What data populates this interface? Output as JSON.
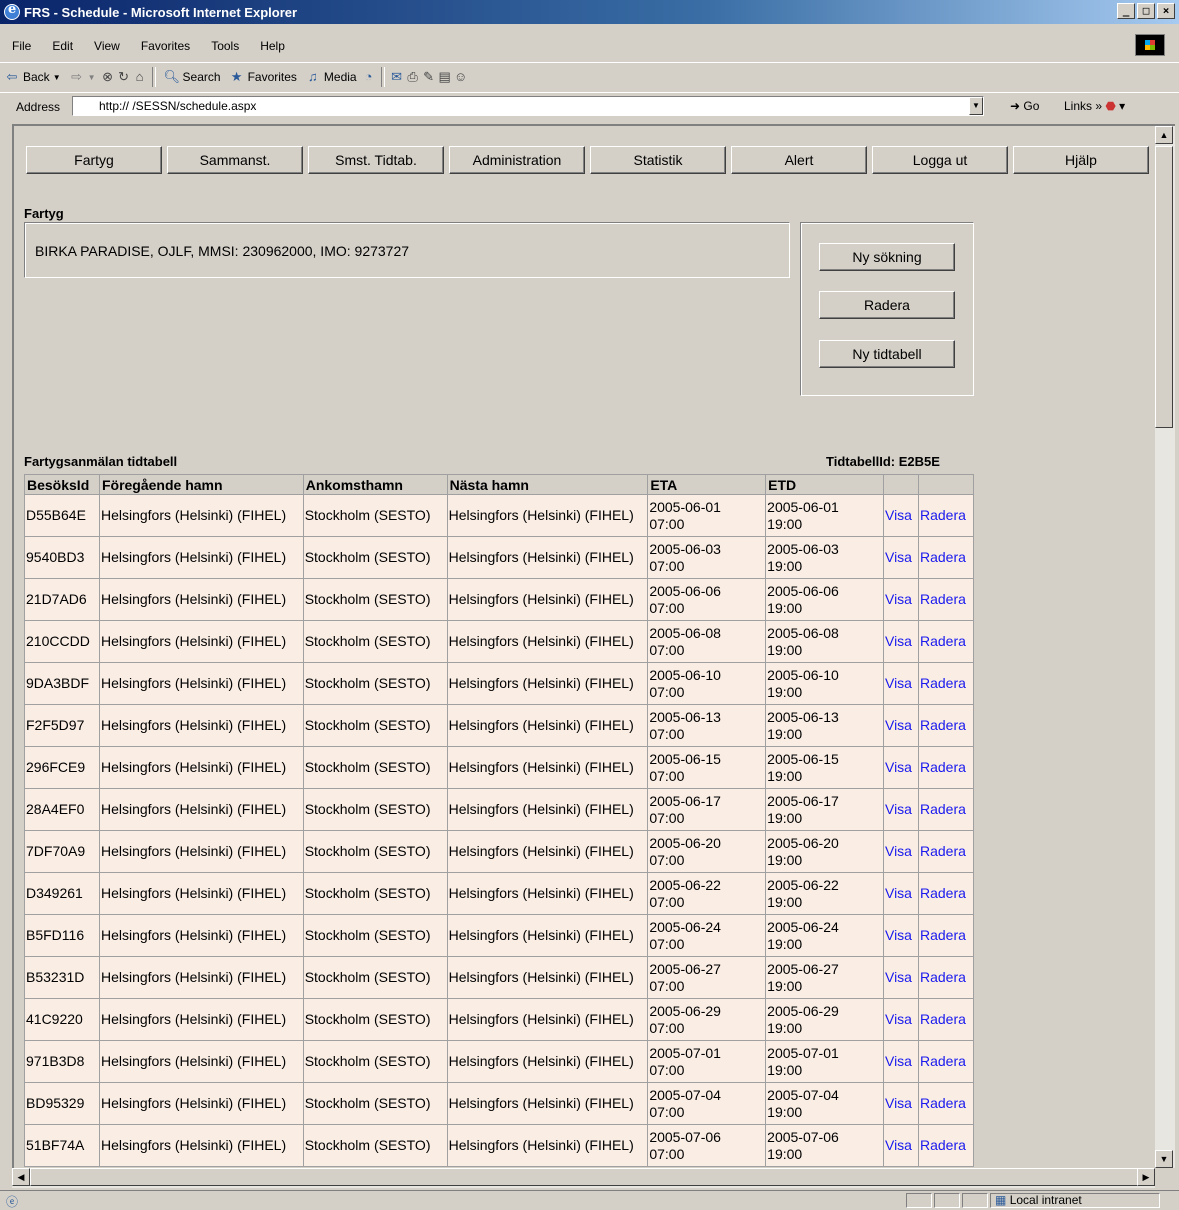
{
  "window": {
    "title": "FRS - Schedule - Microsoft Internet Explorer"
  },
  "menu": [
    "File",
    "Edit",
    "View",
    "Favorites",
    "Tools",
    "Help"
  ],
  "toolbar": {
    "back": "Back",
    "search": "Search",
    "favorites": "Favorites",
    "media": "Media"
  },
  "address": {
    "label": "Address",
    "url": "http://   /SESSN/schedule.aspx",
    "go": "Go",
    "links": "Links"
  },
  "nav": [
    "Fartyg",
    "Sammanst.",
    "Smst. Tidtab.",
    "Administration",
    "Statistik",
    "Alert",
    "Logga ut",
    "Hjälp"
  ],
  "vessel": {
    "heading": "Fartyg",
    "info": "BIRKA PARADISE, OJLF, MMSI: 230962000, IMO: 9273727"
  },
  "actions": {
    "new_search": "Ny sökning",
    "delete": "Radera",
    "new_schedule": "Ny tidtabell"
  },
  "schedule": {
    "heading": "Fartygsanmälan tidtabell",
    "id_label": "TidtabellId: E2B5E",
    "columns": [
      "BesöksId",
      "Föregående hamn",
      "Ankomsthamn",
      "Nästa hamn",
      "ETA",
      "ETD",
      "",
      ""
    ],
    "view_label": "Visa",
    "delete_label": "Radera",
    "rows": [
      {
        "id": "D55B64E",
        "prev": "Helsingfors (Helsinki) (FIHEL)",
        "arr": "Stockholm (SESTO)",
        "next": "Helsingfors (Helsinki) (FIHEL)",
        "eta_date": "2005-06-01",
        "eta_time": "07:00",
        "etd_date": "2005-06-01",
        "etd_time": "19:00"
      },
      {
        "id": "9540BD3",
        "prev": "Helsingfors (Helsinki) (FIHEL)",
        "arr": "Stockholm (SESTO)",
        "next": "Helsingfors (Helsinki) (FIHEL)",
        "eta_date": "2005-06-03",
        "eta_time": "07:00",
        "etd_date": "2005-06-03",
        "etd_time": "19:00"
      },
      {
        "id": "21D7AD6",
        "prev": "Helsingfors (Helsinki) (FIHEL)",
        "arr": "Stockholm (SESTO)",
        "next": "Helsingfors (Helsinki) (FIHEL)",
        "eta_date": "2005-06-06",
        "eta_time": "07:00",
        "etd_date": "2005-06-06",
        "etd_time": "19:00"
      },
      {
        "id": "210CCDD",
        "prev": "Helsingfors (Helsinki) (FIHEL)",
        "arr": "Stockholm (SESTO)",
        "next": "Helsingfors (Helsinki) (FIHEL)",
        "eta_date": "2005-06-08",
        "eta_time": "07:00",
        "etd_date": "2005-06-08",
        "etd_time": "19:00"
      },
      {
        "id": "9DA3BDF",
        "prev": "Helsingfors (Helsinki) (FIHEL)",
        "arr": "Stockholm (SESTO)",
        "next": "Helsingfors (Helsinki) (FIHEL)",
        "eta_date": "2005-06-10",
        "eta_time": "07:00",
        "etd_date": "2005-06-10",
        "etd_time": "19:00"
      },
      {
        "id": "F2F5D97",
        "prev": "Helsingfors (Helsinki) (FIHEL)",
        "arr": "Stockholm (SESTO)",
        "next": "Helsingfors (Helsinki) (FIHEL)",
        "eta_date": "2005-06-13",
        "eta_time": "07:00",
        "etd_date": "2005-06-13",
        "etd_time": "19:00"
      },
      {
        "id": "296FCE9",
        "prev": "Helsingfors (Helsinki) (FIHEL)",
        "arr": "Stockholm (SESTO)",
        "next": "Helsingfors (Helsinki) (FIHEL)",
        "eta_date": "2005-06-15",
        "eta_time": "07:00",
        "etd_date": "2005-06-15",
        "etd_time": "19:00"
      },
      {
        "id": "28A4EF0",
        "prev": "Helsingfors (Helsinki) (FIHEL)",
        "arr": "Stockholm (SESTO)",
        "next": "Helsingfors (Helsinki) (FIHEL)",
        "eta_date": "2005-06-17",
        "eta_time": "07:00",
        "etd_date": "2005-06-17",
        "etd_time": "19:00"
      },
      {
        "id": "7DF70A9",
        "prev": "Helsingfors (Helsinki) (FIHEL)",
        "arr": "Stockholm (SESTO)",
        "next": "Helsingfors (Helsinki) (FIHEL)",
        "eta_date": "2005-06-20",
        "eta_time": "07:00",
        "etd_date": "2005-06-20",
        "etd_time": "19:00"
      },
      {
        "id": "D349261",
        "prev": "Helsingfors (Helsinki) (FIHEL)",
        "arr": "Stockholm (SESTO)",
        "next": "Helsingfors (Helsinki) (FIHEL)",
        "eta_date": "2005-06-22",
        "eta_time": "07:00",
        "etd_date": "2005-06-22",
        "etd_time": "19:00"
      },
      {
        "id": "B5FD116",
        "prev": "Helsingfors (Helsinki) (FIHEL)",
        "arr": "Stockholm (SESTO)",
        "next": "Helsingfors (Helsinki) (FIHEL)",
        "eta_date": "2005-06-24",
        "eta_time": "07:00",
        "etd_date": "2005-06-24",
        "etd_time": "19:00"
      },
      {
        "id": "B53231D",
        "prev": "Helsingfors (Helsinki) (FIHEL)",
        "arr": "Stockholm (SESTO)",
        "next": "Helsingfors (Helsinki) (FIHEL)",
        "eta_date": "2005-06-27",
        "eta_time": "07:00",
        "etd_date": "2005-06-27",
        "etd_time": "19:00"
      },
      {
        "id": "41C9220",
        "prev": "Helsingfors (Helsinki) (FIHEL)",
        "arr": "Stockholm (SESTO)",
        "next": "Helsingfors (Helsinki) (FIHEL)",
        "eta_date": "2005-06-29",
        "eta_time": "07:00",
        "etd_date": "2005-06-29",
        "etd_time": "19:00"
      },
      {
        "id": "971B3D8",
        "prev": "Helsingfors (Helsinki) (FIHEL)",
        "arr": "Stockholm (SESTO)",
        "next": "Helsingfors (Helsinki) (FIHEL)",
        "eta_date": "2005-07-01",
        "eta_time": "07:00",
        "etd_date": "2005-07-01",
        "etd_time": "19:00"
      },
      {
        "id": "BD95329",
        "prev": "Helsingfors (Helsinki) (FIHEL)",
        "arr": "Stockholm (SESTO)",
        "next": "Helsingfors (Helsinki) (FIHEL)",
        "eta_date": "2005-07-04",
        "eta_time": "07:00",
        "etd_date": "2005-07-04",
        "etd_time": "19:00"
      },
      {
        "id": "51BF74A",
        "prev": "Helsingfors (Helsinki) (FIHEL)",
        "arr": "Stockholm (SESTO)",
        "next": "Helsingfors (Helsinki) (FIHEL)",
        "eta_date": "2005-07-06",
        "eta_time": "07:00",
        "etd_date": "2005-07-06",
        "etd_time": "19:00"
      }
    ]
  },
  "status": {
    "zone": "Local intranet"
  }
}
